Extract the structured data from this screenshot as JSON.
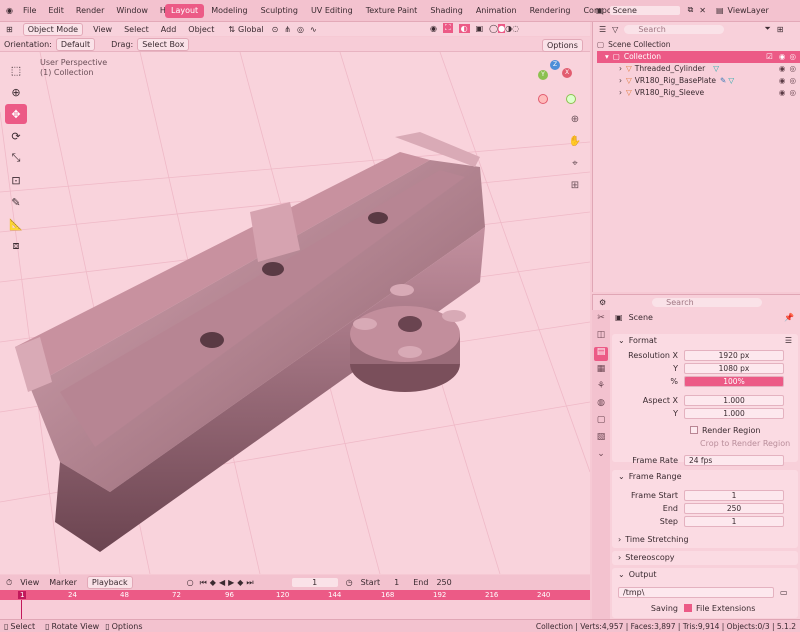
{
  "topbar": {
    "menus": [
      "File",
      "Edit",
      "Render",
      "Window",
      "Help"
    ],
    "workspaces": [
      {
        "label": "Layout",
        "active": true
      },
      {
        "label": "Modeling",
        "active": false
      },
      {
        "label": "Sculpting",
        "active": false
      },
      {
        "label": "UV Editing",
        "active": false
      },
      {
        "label": "Texture Paint",
        "active": false
      },
      {
        "label": "Shading",
        "active": false
      },
      {
        "label": "Animation",
        "active": false
      },
      {
        "label": "Rendering",
        "active": false
      },
      {
        "label": "Compositing",
        "active": false
      }
    ],
    "scene": "Scene",
    "view_layer": "ViewLayer"
  },
  "viewport_header": {
    "mode": "Object Mode",
    "menus": [
      "View",
      "Select",
      "Add",
      "Object"
    ],
    "transform": "Global"
  },
  "tool_header": {
    "orientation_label": "Orientation:",
    "orientation_value": "Default",
    "drag_label": "Drag:",
    "drag_value": "Select Box",
    "options": "Options"
  },
  "viewport": {
    "perspective": "User Perspective",
    "collection": "(1) Collection",
    "gizmo_axes": [
      "X",
      "Y",
      "Z"
    ]
  },
  "outliner": {
    "search_placeholder": "Search",
    "root": "Scene Collection",
    "collection": "Collection",
    "items": [
      "Threaded_Cylinder",
      "VR180_Rig_BasePlate",
      "VR180_Rig_Sleeve"
    ]
  },
  "properties": {
    "search_placeholder": "Search",
    "context": "Scene",
    "format": {
      "title": "Format",
      "resolution_x_label": "Resolution X",
      "resolution_x": "1920 px",
      "y_label": "Y",
      "resolution_y": "1080 px",
      "percent_label": "%",
      "percent": "100%",
      "aspect_x_label": "Aspect X",
      "aspect_x": "1.000",
      "aspect_y_label": "Y",
      "aspect_y": "1.000",
      "render_region": "Render Region",
      "crop_region": "Crop to Render Region",
      "frame_rate_label": "Frame Rate",
      "frame_rate": "24 fps"
    },
    "frame_range": {
      "title": "Frame Range",
      "start_label": "Frame Start",
      "start": "1",
      "end_label": "End",
      "end": "250",
      "step_label": "Step",
      "step": "1",
      "time_stretching": "Time Stretching"
    },
    "stereoscopy": "Stereoscopy",
    "output": {
      "title": "Output",
      "path": "/tmp\\",
      "saving_label": "Saving",
      "file_extensions": "File Extensions"
    }
  },
  "timeline": {
    "menus": [
      "View",
      "Marker"
    ],
    "playback": "Playback",
    "current_frame": "1",
    "start_label": "Start",
    "start": "1",
    "end_label": "End",
    "end": "250",
    "ruler_ticks": [
      "1",
      "24",
      "48",
      "72",
      "96",
      "120",
      "144",
      "168",
      "192",
      "216",
      "240"
    ]
  },
  "statusbar": {
    "select": "Select",
    "rotate": "Rotate View",
    "options": "Options",
    "stats": "Collection | Verts:4,957 | Faces:3,897 | Tris:9,914 | Objects:0/3 | 5.1.2"
  },
  "colors": {
    "accent": "#ec5a86",
    "background": "#f9d3dc",
    "panel": "#f8d0da"
  }
}
